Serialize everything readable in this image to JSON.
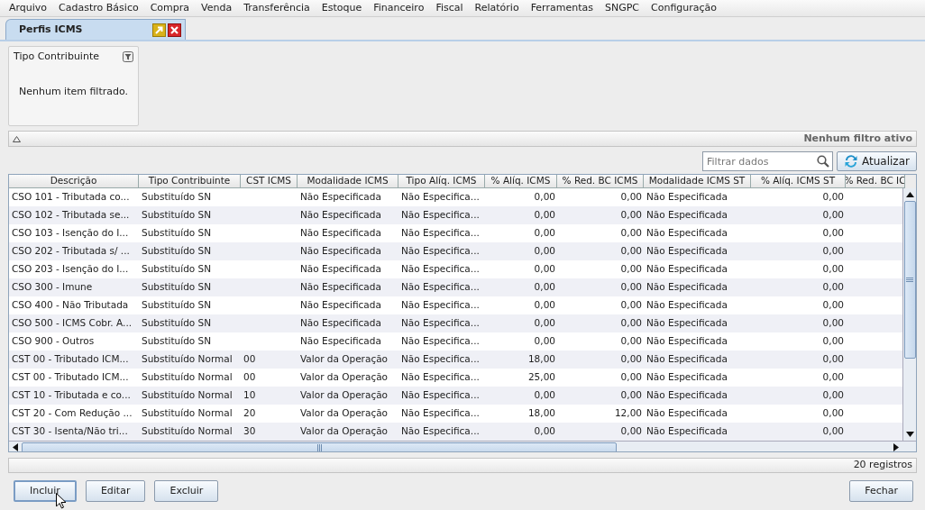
{
  "menu": [
    {
      "label": "Arquivo"
    },
    {
      "label": "Cadastro Básico"
    },
    {
      "label": "Compra"
    },
    {
      "label": "Venda"
    },
    {
      "label": "Transferência"
    },
    {
      "label": "Estoque"
    },
    {
      "label": "Financeiro"
    },
    {
      "label": "Fiscal"
    },
    {
      "label": "Relatório"
    },
    {
      "label": "Ferramentas"
    },
    {
      "label": "SNGPC"
    },
    {
      "label": "Configuração"
    }
  ],
  "tabs": [
    {
      "label": "Perfis ICMS",
      "selected": true
    }
  ],
  "filter_panel": {
    "title": "Tipo Contribuinte",
    "message": "Nenhum item filtrado."
  },
  "filter_bar": {
    "status": "Nenhum filtro ativo"
  },
  "search": {
    "placeholder": "Filtrar dados"
  },
  "refresh_button": "Atualizar",
  "table": {
    "columns": [
      {
        "label": "Descrição",
        "kind": "text"
      },
      {
        "label": "Tipo Contribuinte",
        "kind": "text"
      },
      {
        "label": "CST ICMS",
        "kind": "text"
      },
      {
        "label": "Modalidade ICMS",
        "kind": "text"
      },
      {
        "label": "Tipo Alíq. ICMS",
        "kind": "text"
      },
      {
        "label": "% Alíq. ICMS",
        "kind": "number"
      },
      {
        "label": "% Red. BC ICMS",
        "kind": "number"
      },
      {
        "label": "Modalidade ICMS ST",
        "kind": "text"
      },
      {
        "label": "% Alíq. ICMS ST",
        "kind": "number"
      },
      {
        "label": "% Red. BC IC"
      }
    ],
    "rows": [
      {
        "cells": [
          "CSO 101 - Tributada co...",
          "Substituído SN",
          "",
          "Não Especificada",
          "Não Especifica...",
          "0,00",
          "0,00",
          "Não Especificada",
          "0,00"
        ]
      },
      {
        "cells": [
          "CSO 102 - Tributada se...",
          "Substituído SN",
          "",
          "Não Especificada",
          "Não Especifica...",
          "0,00",
          "0,00",
          "Não Especificada",
          "0,00"
        ]
      },
      {
        "cells": [
          "CSO 103 - Isenção do I...",
          "Substituído SN",
          "",
          "Não Especificada",
          "Não Especifica...",
          "0,00",
          "0,00",
          "Não Especificada",
          "0,00"
        ]
      },
      {
        "cells": [
          "CSO 202 - Tributada s/ ...",
          "Substituído SN",
          "",
          "Não Especificada",
          "Não Especifica...",
          "0,00",
          "0,00",
          "Não Especificada",
          "0,00"
        ]
      },
      {
        "cells": [
          "CSO 203 - Isenção do I...",
          "Substituído SN",
          "",
          "Não Especificada",
          "Não Especifica...",
          "0,00",
          "0,00",
          "Não Especificada",
          "0,00"
        ]
      },
      {
        "cells": [
          "CSO 300 - Imune",
          "Substituído SN",
          "",
          "Não Especificada",
          "Não Especifica...",
          "0,00",
          "0,00",
          "Não Especificada",
          "0,00"
        ]
      },
      {
        "cells": [
          "CSO 400 - Não Tributada",
          "Substituído SN",
          "",
          "Não Especificada",
          "Não Especifica...",
          "0,00",
          "0,00",
          "Não Especificada",
          "0,00"
        ]
      },
      {
        "cells": [
          "CSO 500 - ICMS Cobr. A...",
          "Substituído SN",
          "",
          "Não Especificada",
          "Não Especifica...",
          "0,00",
          "0,00",
          "Não Especificada",
          "0,00"
        ]
      },
      {
        "cells": [
          "CSO 900 - Outros",
          "Substituído SN",
          "",
          "Não Especificada",
          "Não Especifica...",
          "0,00",
          "0,00",
          "Não Especificada",
          "0,00"
        ]
      },
      {
        "cells": [
          "CST 00 - Tributado ICM...",
          "Substituído Normal",
          "00",
          "Valor da Operação",
          "Não Especifica...",
          "18,00",
          "0,00",
          "Não Especificada",
          "0,00"
        ]
      },
      {
        "cells": [
          "CST 00 - Tributado ICM...",
          "Substituído Normal",
          "00",
          "Valor da Operação",
          "Não Especifica...",
          "25,00",
          "0,00",
          "Não Especificada",
          "0,00"
        ]
      },
      {
        "cells": [
          "CST 10 - Tributada e co...",
          "Substituído Normal",
          "10",
          "Valor da Operação",
          "Não Especifica...",
          "0,00",
          "0,00",
          "Não Especificada",
          "0,00"
        ]
      },
      {
        "cells": [
          "CST 20 - Com Redução ...",
          "Substituído Normal",
          "20",
          "Valor da Operação",
          "Não Especifica...",
          "18,00",
          "12,00",
          "Não Especificada",
          "0,00"
        ]
      },
      {
        "cells": [
          "CST 30 - Isenta/Não tri...",
          "Substituído Normal",
          "30",
          "Valor da Operação",
          "Não Especifica...",
          "0,00",
          "0,00",
          "Não Especificada",
          "0,00"
        ]
      }
    ]
  },
  "record_count": "20 registros",
  "buttons": [
    {
      "label": "Incluir",
      "focused": true
    },
    {
      "label": "Editar",
      "focused": false
    },
    {
      "label": "Excluir",
      "focused": false
    }
  ],
  "close_button": "Fechar"
}
